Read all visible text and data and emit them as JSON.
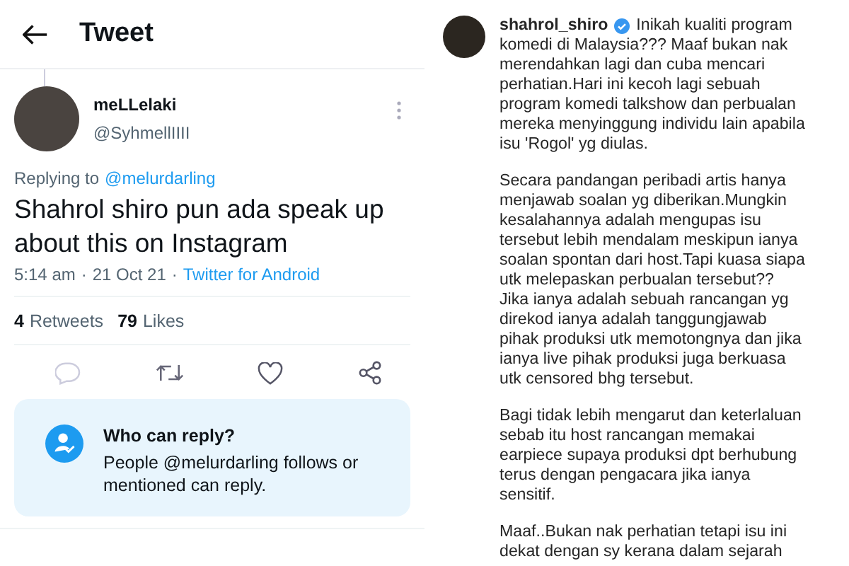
{
  "tweet_screen": {
    "header": {
      "title": "Tweet"
    },
    "author": {
      "name": "meLLelaki",
      "handle": "@SyhmellIIII"
    },
    "replying_to": {
      "label": "Replying to",
      "mention": "@melurdarling"
    },
    "text": "Shahrol shiro pun ada speak up\nabout this on Instagram",
    "meta": {
      "time": "5:14 am",
      "separator": "·",
      "date": "21 Oct 21",
      "separator_2": "·",
      "source": "Twitter for Android"
    },
    "stats": [
      {
        "count": "4",
        "label": "Retweets"
      },
      {
        "count": "79",
        "label": "Likes"
      }
    ],
    "actions": [
      {
        "kind": "reply"
      },
      {
        "kind": "retweet"
      },
      {
        "kind": "like"
      },
      {
        "kind": "share"
      }
    ],
    "reply_notice": {
      "title": "Who can reply?",
      "body": "People @melurdarling follows or\nmentioned can reply."
    }
  },
  "instagram_post": {
    "username": "shahrol_shiro",
    "verified": true,
    "caption_start": "Inikah kualiti program",
    "paragraphs": [
      "komedi di Malaysia??? Maaf bukan nak\nmerendahkan lagi dan cuba mencari\nperhatian.Hari ini kecoh lagi sebuah\nprogram komedi talkshow dan perbualan\nmereka menyinggung individu lain apabila\nisu 'Rogol' yg diulas.",
      "Secara pandangan peribadi artis hanya\nmenjawab soalan yg diberikan.Mungkin\nkesalahannya adalah mengupas isu\ntersebut lebih mendalam meskipun ianya\nsoalan spontan dari host.Tapi kuasa siapa\nutk melepaskan perbualan tersebut??\nJika ianya adalah sebuah rancangan yg\ndirekod ianya adalah tanggungjawab\npihak produksi utk memotongnya dan jika\nianya live pihak produksi juga berkuasa\nutk censored bhg tersebut.",
      "Bagi tidak lebih mengarut dan keterlaluan\nsebab itu host rancangan memakai\nearpiece supaya produksi dpt berhubung\nterus dengan pengacara jika ianya\nsensitif.",
      "Maaf..Bukan nak perhatian tetapi isu ini\ndekat dengan sy kerana dalam sejarah"
    ]
  }
}
